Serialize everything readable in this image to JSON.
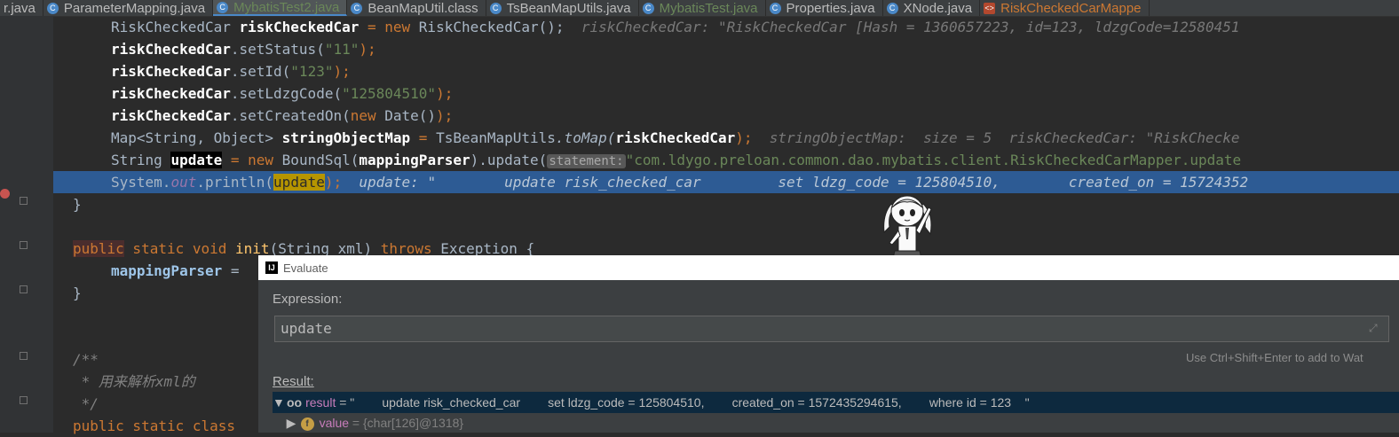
{
  "tabs": [
    {
      "label": "r.java",
      "icon": "",
      "state": "normal"
    },
    {
      "label": "ParameterMapping.java",
      "icon": "class-icon",
      "state": "normal"
    },
    {
      "label": "MybatisTest2.java",
      "icon": "class-icon",
      "state": "active"
    },
    {
      "label": "BeanMapUtil.class",
      "icon": "class-icon",
      "state": "normal"
    },
    {
      "label": "TsBeanMapUtils.java",
      "icon": "class-icon",
      "state": "normal"
    },
    {
      "label": "MybatisTest.java",
      "icon": "class-icon",
      "state": "green"
    },
    {
      "label": "Properties.java",
      "icon": "class-icon",
      "state": "normal"
    },
    {
      "label": "XNode.java",
      "icon": "class-icon",
      "state": "normal"
    },
    {
      "label": "RiskCheckedCarMappe",
      "icon": "xml-icon",
      "state": "orange"
    }
  ],
  "code": {
    "l1": {
      "type": "RiskCheckedCar ",
      "var": "riskCheckedCar",
      "op": " = ",
      "kw": "new ",
      "ctor": "RiskCheckedCar();",
      "inlay": "riskCheckedCar: \"RiskCheckedCar [Hash = 1360657223, id=123, ldzgCode=12580451"
    },
    "l2": {
      "var": "riskCheckedCar",
      "call": ".setStatus(",
      "arg": "\"11\"",
      "end": ");"
    },
    "l3": {
      "var": "riskCheckedCar",
      "call": ".setId(",
      "arg": "\"123\"",
      "end": ");"
    },
    "l4": {
      "var": "riskCheckedCar",
      "call": ".setLdzgCode(",
      "arg": "\"125804510\"",
      "end": ");"
    },
    "l5": {
      "var": "riskCheckedCar",
      "call": ".setCreatedOn(",
      "kw": "new ",
      "arg": "Date()",
      "end": ");"
    },
    "l6": {
      "type": "Map<String, Object> ",
      "var": "stringObjectMap",
      "op": " = ",
      "cls": "TsBeanMapUtils",
      "call": ".toMap(",
      "arg": "riskCheckedCar",
      "end": ");",
      "inlay": "stringObjectMap:  size = 5  riskCheckedCar: \"RiskChecke"
    },
    "l7": {
      "type": "String ",
      "var": "update",
      "op": " = ",
      "kw": "new ",
      "cls": "BoundSql(",
      "arg": "mappingParser",
      "call": ").update(",
      "param": "statement:",
      "str": "\"com.ldygo.preloan.common.dao.mybatis.client.RiskCheckedCarMapper.update"
    },
    "l8": {
      "cls": "System.",
      "fld": "out",
      "call": ".println(",
      "arg": "update",
      "end": ");",
      "inlay": "update: \"        update risk_checked_car         set ldzg_code = 125804510,        created_on = 15724352"
    },
    "l9": {
      "text": "}"
    },
    "l11": {
      "kw1": "public",
      "kw2": " static void ",
      "fn": "init",
      "sig": "(String ",
      "param": "xml",
      "close": ") ",
      "kw3": "throws ",
      "cls": "Exception {"
    },
    "l12": {
      "var": "mappingParser",
      "op": " ="
    },
    "l13": {
      "text": "}"
    },
    "l16": {
      "text": "/**"
    },
    "l17": {
      "text": " * 用来解析xml的"
    },
    "l18": {
      "text": " */"
    },
    "l19": {
      "kw": "public static class"
    }
  },
  "dialog": {
    "title": "Evaluate",
    "expression_label": "Expression:",
    "expression_value": "update",
    "hint": "Use Ctrl+Shift+Enter to add to Wat",
    "result_label": "Result:",
    "result_name": "result",
    "result_value": " = \"        update risk_checked_car        set ldzg_code = 125804510,        created_on = 1572435294615,        where id = 123    \"",
    "child_name": "value",
    "child_value": " = {char[126]@1318}"
  }
}
